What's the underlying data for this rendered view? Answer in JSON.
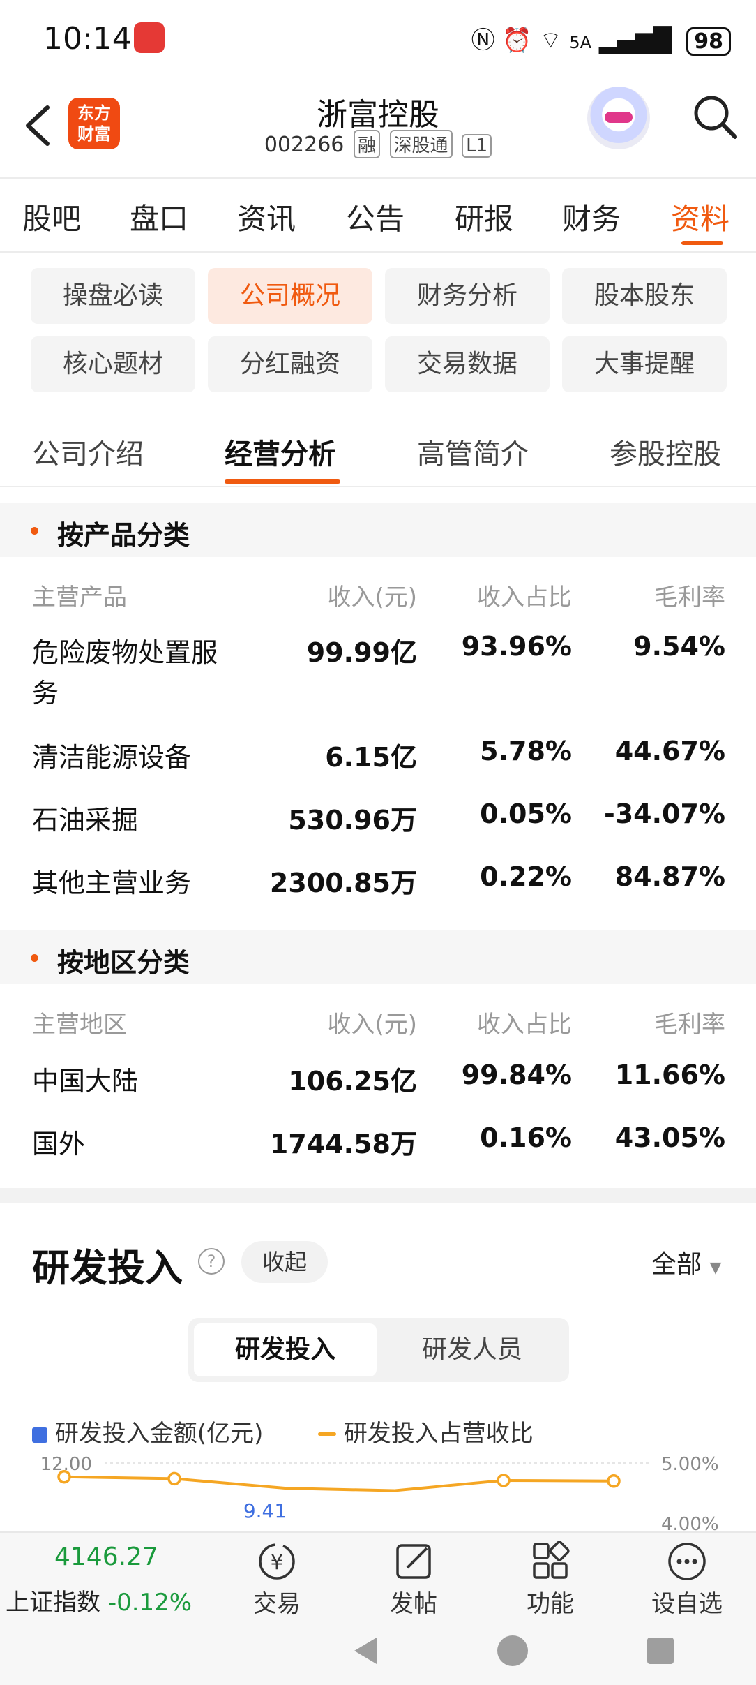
{
  "status_bar": {
    "time": "10:14",
    "network": "5A",
    "battery": "98"
  },
  "header": {
    "title": "浙富控股",
    "code": "002266",
    "tags": [
      "融",
      "深股通",
      "L1"
    ],
    "logo_text_1": "东方",
    "logo_text_2": "财富"
  },
  "main_tabs": [
    "股吧",
    "盘口",
    "资讯",
    "公告",
    "研报",
    "财务",
    "资料"
  ],
  "chips": [
    "操盘必读",
    "公司概况",
    "财务分析",
    "股本股东",
    "核心题材",
    "分红融资",
    "交易数据",
    "大事提醒"
  ],
  "sub_tabs": [
    "公司介绍",
    "经营分析",
    "高管简介",
    "参股控股"
  ],
  "by_product": {
    "title": "按产品分类",
    "headers": [
      "主营产品",
      "收入(元)",
      "收入占比",
      "毛利率"
    ],
    "rows": [
      {
        "name_l1": "危险废物处置服",
        "name_l2": "务",
        "revenue": "99.99亿",
        "ratio": "93.96%",
        "margin": "9.54%"
      },
      {
        "name_l1": "清洁能源设备",
        "name_l2": "",
        "revenue": "6.15亿",
        "ratio": "5.78%",
        "margin": "44.67%"
      },
      {
        "name_l1": "石油采掘",
        "name_l2": "",
        "revenue": "530.96万",
        "ratio": "0.05%",
        "margin": "-34.07%"
      },
      {
        "name_l1": "其他主营业务",
        "name_l2": "",
        "revenue": "2300.85万",
        "ratio": "0.22%",
        "margin": "84.87%"
      }
    ]
  },
  "by_region": {
    "title": "按地区分类",
    "headers": [
      "主营地区",
      "收入(元)",
      "收入占比",
      "毛利率"
    ],
    "rows": [
      {
        "name": "中国大陆",
        "revenue": "106.25亿",
        "ratio": "99.84%",
        "margin": "11.66%"
      },
      {
        "name": "国外",
        "revenue": "1744.58万",
        "ratio": "0.16%",
        "margin": "43.05%"
      }
    ]
  },
  "rd": {
    "title": "研发投入",
    "help": "?",
    "collapse": "收起",
    "filter": "全部",
    "segments": [
      "研发投入",
      "研发人员"
    ],
    "legend": [
      "研发投入金额(亿元)",
      "研发投入占营收比"
    ],
    "colors": {
      "bar": "#3f6fe0",
      "line": "#f5a623"
    }
  },
  "chart_data": {
    "type": "line",
    "y_left_ticks": [
      "12.00"
    ],
    "y_right_ticks": [
      "5.00%",
      "4.00%"
    ],
    "series": [
      {
        "name": "研发投入占营收比",
        "values": [
          4.77,
          4.74,
          4.58,
          4.54,
          4.71,
          4.7
        ]
      }
    ],
    "data_labels": [
      "9.41"
    ]
  },
  "bottom_bar": {
    "index_value": "4146.27",
    "index_name": "上证指数",
    "index_change": "-0.12%",
    "items": [
      "交易",
      "发帖",
      "功能",
      "设自选"
    ]
  }
}
